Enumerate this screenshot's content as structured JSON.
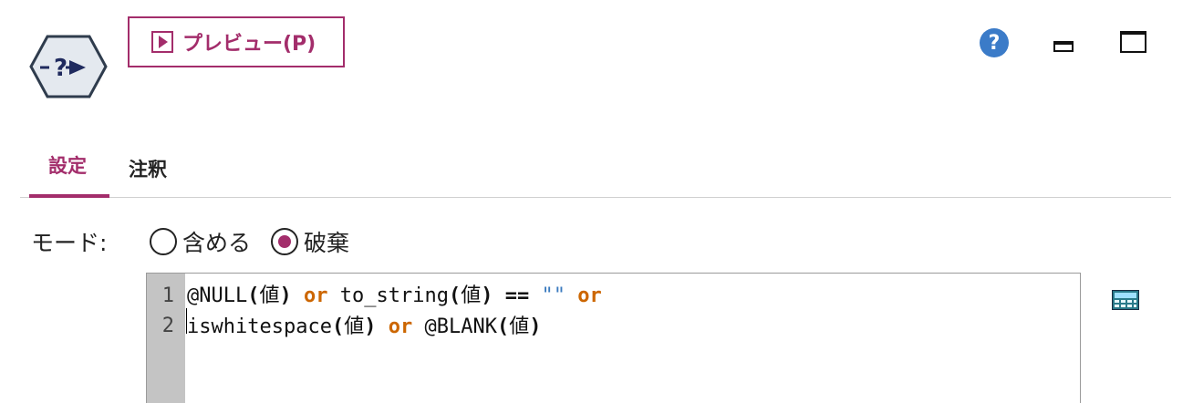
{
  "toolbar": {
    "preview_label": "プレビュー(P)",
    "help_glyph": "?"
  },
  "tabs": [
    {
      "label": "設定",
      "active": true
    },
    {
      "label": "注釈",
      "active": false
    }
  ],
  "mode": {
    "label": "モード:",
    "options": [
      {
        "label": "含める",
        "selected": false
      },
      {
        "label": "破棄",
        "selected": true
      }
    ]
  },
  "editor": {
    "line_numbers": [
      "1",
      "2"
    ],
    "lines": [
      "@NULL(値) or to_string(値) == \"\" or",
      "iswhitespace(値) or @BLANK(値)"
    ]
  },
  "icons": {
    "node": "select-node-icon",
    "help": "help-icon",
    "minimize": "minimize-icon",
    "maximize": "maximize-icon",
    "expression_builder": "expression-builder-icon"
  },
  "colors": {
    "accent": "#a32d6b",
    "keyword": "#cc6600",
    "string": "#3b7bbf",
    "help": "#3b7bc8"
  }
}
